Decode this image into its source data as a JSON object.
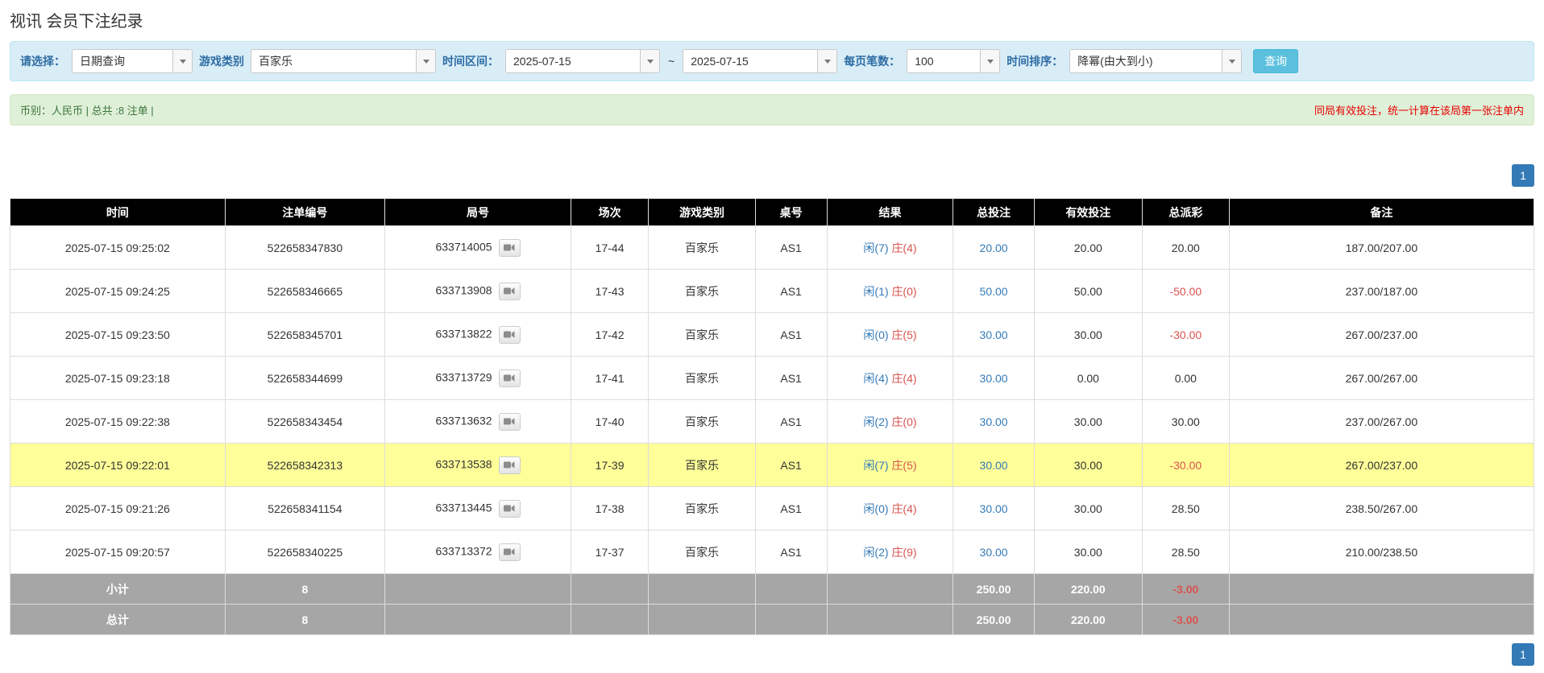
{
  "page_title": "视讯 会员下注纪录",
  "filters": {
    "select_label": "请选择：",
    "select_value": "日期查询",
    "game_type_label": "游戏类别",
    "game_type_value": "百家乐",
    "date_range_label": "时间区间：",
    "date_from": "2025-07-15",
    "date_separator": "~",
    "date_to": "2025-07-15",
    "page_size_label": "每页笔数：",
    "page_size_value": "100",
    "sort_label": "时间排序：",
    "sort_value": "降幂(由大到小)",
    "search_button_label": "查询"
  },
  "summary": {
    "info_text": "币别：人民币 | 总共 :8 注单 |",
    "notice_text": "同局有效投注，统一计算在该局第一张注单内"
  },
  "pagination": {
    "current_page": "1"
  },
  "colors": {
    "accent_blue": "#337ab7",
    "banker_red": "#d9534f",
    "negative_red": "#d9534f",
    "notice_red": "#e60000",
    "highlight_yellow": "#ffff99",
    "header_black": "#000000",
    "footer_gray": "#a6a6a6",
    "filter_bar_blue": "#d9edf7",
    "summary_bar_green": "#dff0d8",
    "search_button_blue": "#5bc0de"
  },
  "table": {
    "headers": [
      "时间",
      "注单编号",
      "局号",
      "场次",
      "游戏类别",
      "桌号",
      "结果",
      "总投注",
      "有效投注",
      "总派彩",
      "备注"
    ],
    "rows": [
      {
        "time": "2025-07-15 09:25:02",
        "bet_id": "522658347830",
        "round_id": "633714005",
        "session": "17-44",
        "game_type": "百家乐",
        "table_no": "AS1",
        "result_player": "闲(7)",
        "result_banker": "庄(4)",
        "total_bet": "20.00",
        "valid_bet": "20.00",
        "payout": "20.00",
        "note": "187.00/207.00",
        "highlighted": false
      },
      {
        "time": "2025-07-15 09:24:25",
        "bet_id": "522658346665",
        "round_id": "633713908",
        "session": "17-43",
        "game_type": "百家乐",
        "table_no": "AS1",
        "result_player": "闲(1)",
        "result_banker": "庄(0)",
        "total_bet": "50.00",
        "valid_bet": "50.00",
        "payout": "-50.00",
        "note": "237.00/187.00",
        "highlighted": false
      },
      {
        "time": "2025-07-15 09:23:50",
        "bet_id": "522658345701",
        "round_id": "633713822",
        "session": "17-42",
        "game_type": "百家乐",
        "table_no": "AS1",
        "result_player": "闲(0)",
        "result_banker": "庄(5)",
        "total_bet": "30.00",
        "valid_bet": "30.00",
        "payout": "-30.00",
        "note": "267.00/237.00",
        "highlighted": false
      },
      {
        "time": "2025-07-15 09:23:18",
        "bet_id": "522658344699",
        "round_id": "633713729",
        "session": "17-41",
        "game_type": "百家乐",
        "table_no": "AS1",
        "result_player": "闲(4)",
        "result_banker": "庄(4)",
        "total_bet": "30.00",
        "valid_bet": "0.00",
        "payout": "0.00",
        "note": "267.00/267.00",
        "highlighted": false
      },
      {
        "time": "2025-07-15 09:22:38",
        "bet_id": "522658343454",
        "round_id": "633713632",
        "session": "17-40",
        "game_type": "百家乐",
        "table_no": "AS1",
        "result_player": "闲(2)",
        "result_banker": "庄(0)",
        "total_bet": "30.00",
        "valid_bet": "30.00",
        "payout": "30.00",
        "note": "237.00/267.00",
        "highlighted": false
      },
      {
        "time": "2025-07-15 09:22:01",
        "bet_id": "522658342313",
        "round_id": "633713538",
        "session": "17-39",
        "game_type": "百家乐",
        "table_no": "AS1",
        "result_player": "闲(7)",
        "result_banker": "庄(5)",
        "total_bet": "30.00",
        "valid_bet": "30.00",
        "payout": "-30.00",
        "note": "267.00/237.00",
        "highlighted": true
      },
      {
        "time": "2025-07-15 09:21:26",
        "bet_id": "522658341154",
        "round_id": "633713445",
        "session": "17-38",
        "game_type": "百家乐",
        "table_no": "AS1",
        "result_player": "闲(0)",
        "result_banker": "庄(4)",
        "total_bet": "30.00",
        "valid_bet": "30.00",
        "payout": "28.50",
        "note": "238.50/267.00",
        "highlighted": false
      },
      {
        "time": "2025-07-15 09:20:57",
        "bet_id": "522658340225",
        "round_id": "633713372",
        "session": "17-37",
        "game_type": "百家乐",
        "table_no": "AS1",
        "result_player": "闲(2)",
        "result_banker": "庄(9)",
        "total_bet": "30.00",
        "valid_bet": "30.00",
        "payout": "28.50",
        "note": "210.00/238.50",
        "highlighted": false
      }
    ],
    "subtotal": {
      "label": "小计",
      "count": "8",
      "total_bet": "250.00",
      "valid_bet": "220.00",
      "payout": "-3.00"
    },
    "grand_total": {
      "label": "总计",
      "count": "8",
      "total_bet": "250.00",
      "valid_bet": "220.00",
      "payout": "-3.00"
    }
  }
}
